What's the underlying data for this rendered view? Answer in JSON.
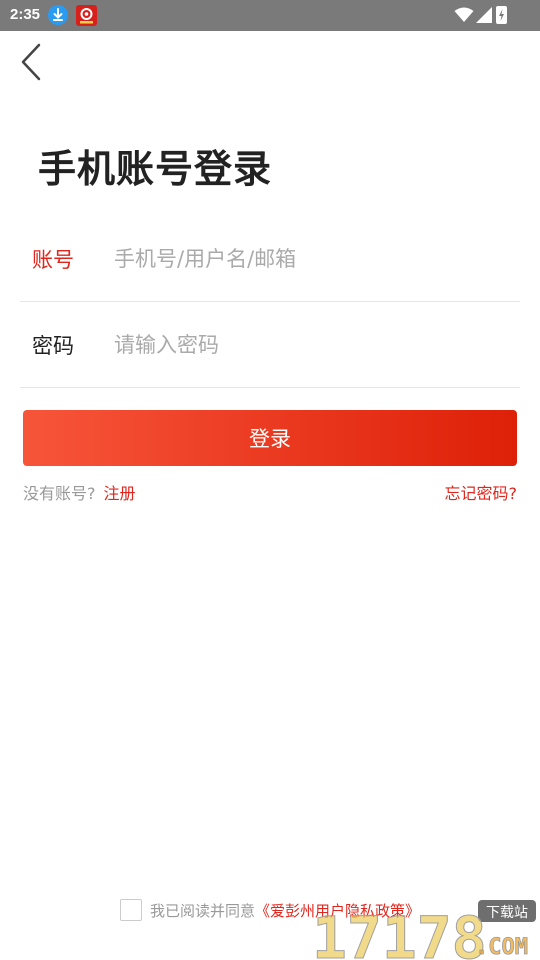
{
  "status_bar": {
    "time": "2:35"
  },
  "title": "手机账号登录",
  "form": {
    "account": {
      "label": "账号",
      "placeholder": "手机号/用户名/邮箱"
    },
    "password": {
      "label": "密码",
      "placeholder": "请输入密码"
    },
    "submit_label": "登录"
  },
  "links": {
    "no_account": "没有账号?",
    "register": "注册",
    "forgot": "忘记密码?"
  },
  "agreement": {
    "prefix": "我已阅读并同意",
    "policy": "《爱彭州用户隐私政策》"
  },
  "watermark": {
    "badge": "下载站",
    "brand_top": "17178",
    "brand_suffix": ".COM"
  },
  "colors": {
    "accent": "#e0261c",
    "button_start": "#f7553a",
    "button_end": "#de2008",
    "status_bar": "#7a7a7a"
  }
}
